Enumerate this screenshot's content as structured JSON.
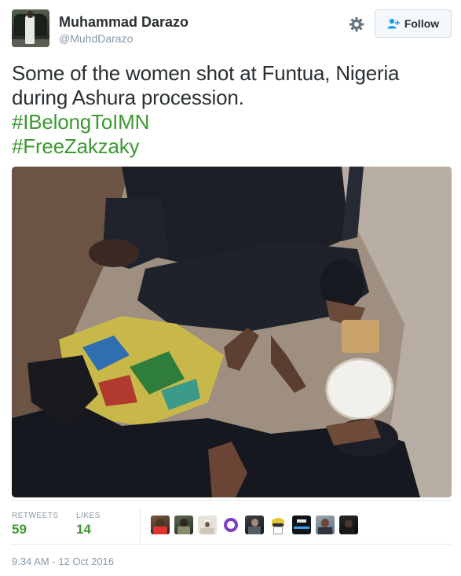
{
  "user": {
    "name": "Muhammad Darazo",
    "handle": "@MuhdDarazo",
    "avatar_icon": "profile-avatar"
  },
  "actions": {
    "settings_icon": "gear-icon",
    "follow_label": "Follow",
    "follow_icon": "add-user-icon"
  },
  "tweet": {
    "text": "Some of the women shot at Funtua, Nigeria during Ashura procession.",
    "hashtags": [
      "#IBelongToIMN",
      "#FreeZakzaky"
    ],
    "hashtag_color": "#3b9a2f"
  },
  "stats": {
    "retweets_label": "RETWEETS",
    "retweets_value": "59",
    "likes_label": "LIKES",
    "likes_value": "14",
    "liker_avatar_count": 9
  },
  "timestamp": "9:34 AM - 12 Oct 2016",
  "colors": {
    "text": "#292f33",
    "muted": "#8899a6",
    "accent_green": "#3b9a2f",
    "border": "#e1e8ed"
  }
}
